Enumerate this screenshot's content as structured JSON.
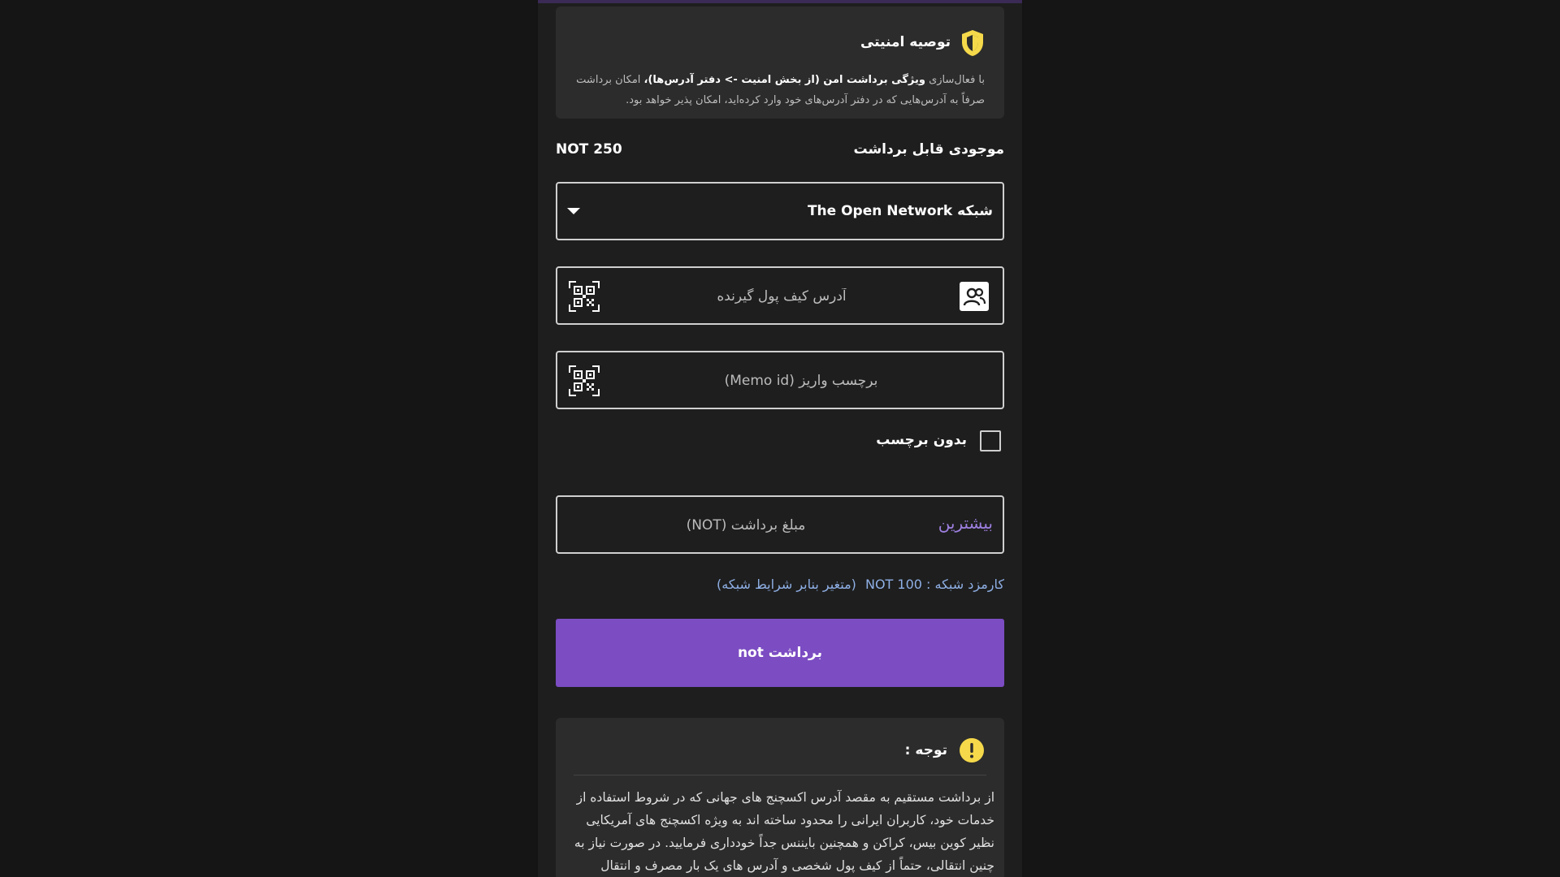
{
  "security": {
    "title": "توصیه امنیتی",
    "body_prefix": "با فعال‌سازی ",
    "body_bold": "ویژگی برداشت امن (از بخش امنیت -> دفتر آدرس‌ها)،",
    "body_suffix": " امکان برداشت صرفاً به آدرس‌هایی که در دفتر آدرس‌های خود وارد کرده‌اید، امکان پذیر خواهد بود."
  },
  "balance": {
    "label": "موجودی قابل برداشت",
    "value": "NOT 250"
  },
  "network": {
    "label": "شبکه The Open Network"
  },
  "address": {
    "placeholder": "آدرس کیف پول گیرنده"
  },
  "memo": {
    "placeholder": "برچسب واریز (Memo id)",
    "no_memo_label": "بدون برچسب"
  },
  "amount": {
    "placeholder": "مبلغ برداشت (NOT)",
    "max_label": "بیشترین"
  },
  "fee": {
    "label": "کارمزد شبکه : NOT 100",
    "note": "(متغیر بنابر شرایط شبکه)"
  },
  "withdraw": {
    "label": "برداشت not"
  },
  "notice": {
    "title": "توجه :",
    "body": "از برداشت مستقیم به مقصد آدرس اکسچنج های جهانی که در شروط استفاده از خدمات خود، کاربران ایرانی را محدود ساخته اند به ویژه اکسچنج های آمریکایی نظیر کوین بیس، کراکن و همچنین بایننس جداً خودداری فرمایید. در صورت نیاز به چنین انتقالی، حتماً از کیف پول شخصی و آدرس های یک بار مصرف و انتقال"
  },
  "colors": {
    "accent": "#7b4cc2",
    "max_link": "#9d7fe0",
    "fee_text": "#8fb0e6",
    "warning": "#f5d94a"
  }
}
